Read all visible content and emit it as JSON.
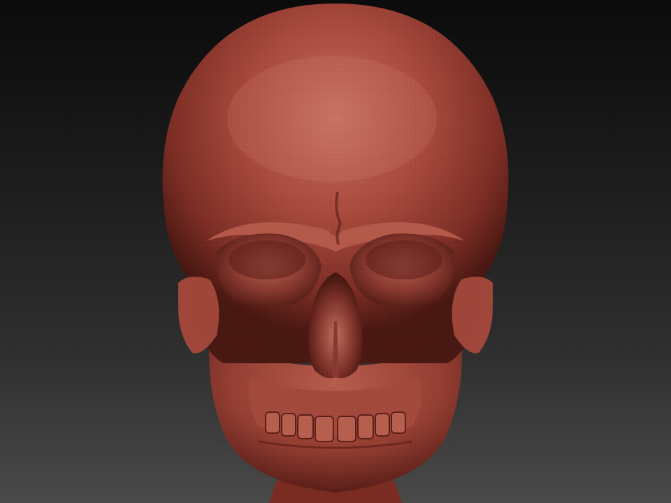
{
  "viewport": {
    "background_top": "#0b0b0b",
    "background_bottom": "#4a4a4a"
  },
  "model": {
    "subject": "skull-sculpt",
    "material_color": "#a8483c",
    "material_highlight": "#c9705f",
    "material_shadow": "#3d130f"
  }
}
